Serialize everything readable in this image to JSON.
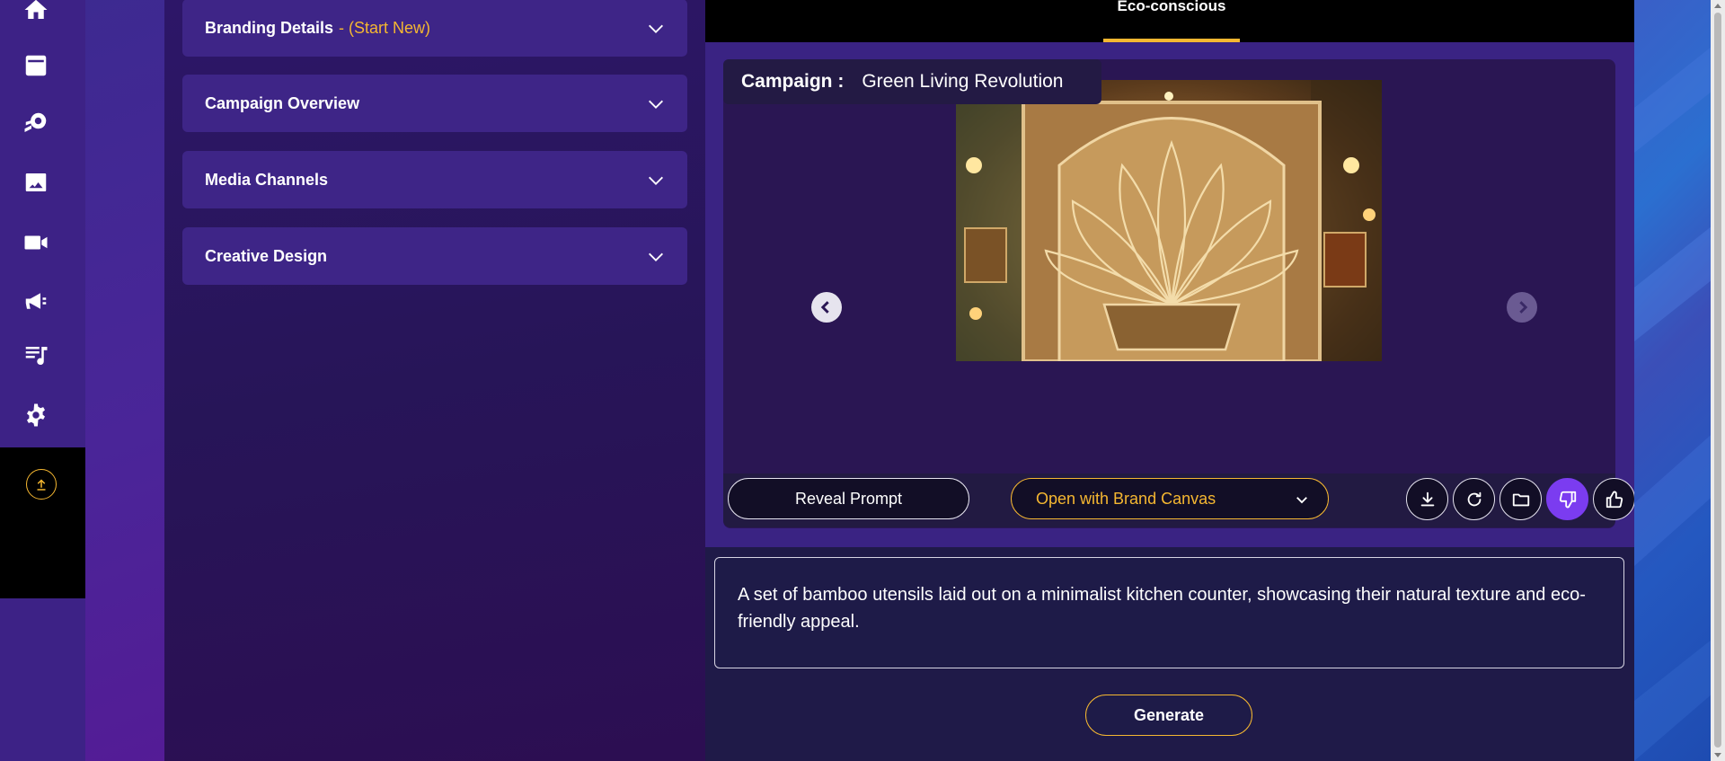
{
  "rail": {
    "icons": [
      "home-icon",
      "archive-icon",
      "campaign-icon",
      "image-icon",
      "video-icon",
      "megaphone-icon",
      "music-note-icon",
      "gear-icon",
      "upload-icon"
    ]
  },
  "form": {
    "sections": [
      {
        "title": "Branding Details",
        "subtitle": "- (Start New)"
      },
      {
        "title": "Campaign Overview"
      },
      {
        "title": "Media Channels"
      },
      {
        "title": "Creative Design"
      }
    ]
  },
  "tabs": {
    "active": "Eco-conscious"
  },
  "viewer": {
    "campaign_label": "Campaign :",
    "campaign_name": "Green Living Revolution",
    "image_subject": "ornate mandala lotus relief artwork"
  },
  "actions": {
    "reveal_prompt": "Reveal Prompt",
    "brand_canvas": "Open with Brand Canvas",
    "icon_buttons": [
      "download-icon",
      "refresh-icon",
      "folder-icon",
      "thumbs-down-icon",
      "thumbs-up-icon"
    ]
  },
  "prompt": {
    "value": "A set of bamboo utensils laid out on a minimalist kitchen counter, showcasing their natural texture and eco-friendly appeal."
  },
  "generate_label": "Generate",
  "colors": {
    "accent": "#f5b731",
    "active_feedback": "#7b3cf0",
    "panel": "#3e2587"
  }
}
